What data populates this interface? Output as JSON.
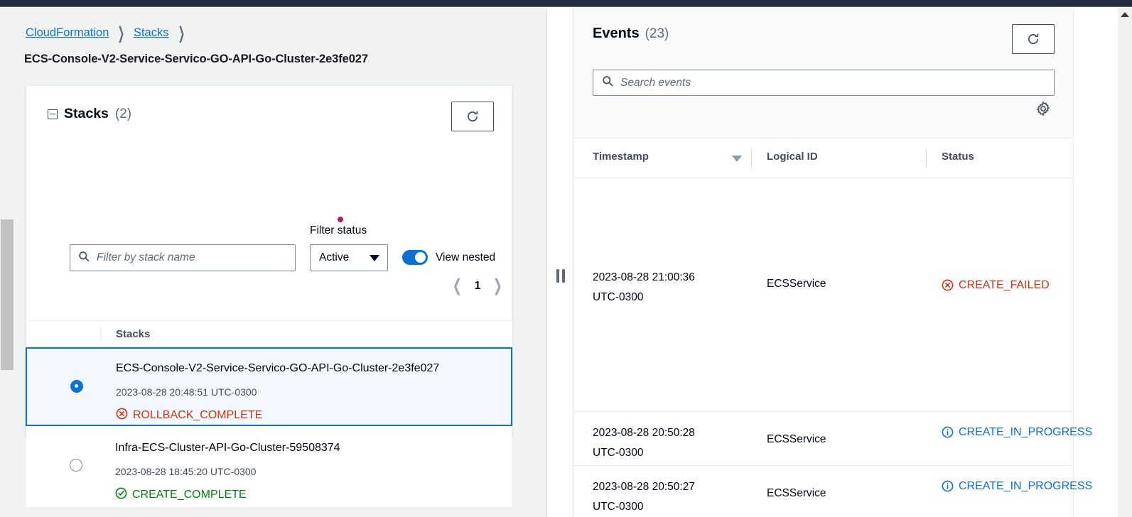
{
  "breadcrumb": {
    "items": [
      {
        "label": "CloudFormation",
        "link": true
      },
      {
        "label": "Stacks",
        "link": true
      }
    ],
    "separator": "❯"
  },
  "page_title": "ECS-Console-V2-Service-Servico-GO-API-Go-Cluster-2e3fe027",
  "stacks_panel": {
    "heading": "Stacks",
    "count_label": "(2)",
    "collapse_icon": "minus-square-icon",
    "refresh_icon": "refresh-icon",
    "filter_input": {
      "placeholder": "Filter by stack name",
      "value": "",
      "icon": "search-icon"
    },
    "filter_status": {
      "label": "Filter status",
      "selected": "Active",
      "caret_icon": "caret-down-icon"
    },
    "view_nested": {
      "label": "View nested",
      "enabled": true
    },
    "pagination": {
      "prev_icon": "chevron-left-icon",
      "page": "1",
      "next_icon": "chevron-right-icon"
    },
    "table": {
      "column_header": "Stacks",
      "rows": [
        {
          "name": "ECS-Console-V2-Service-Servico-GO-API-Go-Cluster-2e3fe027",
          "timestamp": "2023-08-28 20:48:51 UTC-0300",
          "status": "ROLLBACK_COMPLETE",
          "status_kind": "error",
          "status_icon": "error-circle-x-icon",
          "selected": true
        },
        {
          "name": "Infra-ECS-Cluster-API-Go-Cluster-59508374",
          "timestamp": "2023-08-28 18:45:20 UTC-0300",
          "status": "CREATE_COMPLETE",
          "status_kind": "success",
          "status_icon": "success-circle-check-icon",
          "selected": false
        }
      ]
    }
  },
  "splitter": {
    "handle_icon": "drag-handle-vertical-icon"
  },
  "events_panel": {
    "heading": "Events",
    "count_label": "(23)",
    "refresh_icon": "refresh-icon",
    "settings_icon": "gear-icon",
    "search": {
      "placeholder": "Search events",
      "value": "",
      "icon": "search-icon"
    },
    "columns": [
      {
        "label": "Timestamp",
        "sort_icon": "caret-down-icon"
      },
      {
        "label": "Logical ID"
      },
      {
        "label": "Status"
      }
    ],
    "rows": [
      {
        "timestamp": "2023-08-28 21:00:36 UTC-0300",
        "logical_id": "ECSService",
        "status": "CREATE_FAILED",
        "status_kind": "error",
        "status_icon": "error-circle-x-icon"
      },
      {
        "timestamp": "2023-08-28 20:50:28 UTC-0300",
        "logical_id": "ECSService",
        "status": "CREATE_IN_PROGRESS",
        "status_kind": "info",
        "status_icon": "info-circle-icon"
      },
      {
        "timestamp": "2023-08-28 20:50:27 UTC-0300",
        "logical_id": "ECSService",
        "status": "CREATE_IN_PROGRESS",
        "status_kind": "info",
        "status_icon": "info-circle-icon"
      }
    ]
  },
  "scrollbar": {
    "up_icon": "triangle-up-icon"
  },
  "colors": {
    "topnav": "#232f3e",
    "link": "#0972d3",
    "error": "#d13212",
    "success": "#037f0c",
    "info": "#0972d3",
    "accent": "#0972d3",
    "page_bg": "#f1f3f3",
    "cursor_marker": "#b2186b"
  }
}
